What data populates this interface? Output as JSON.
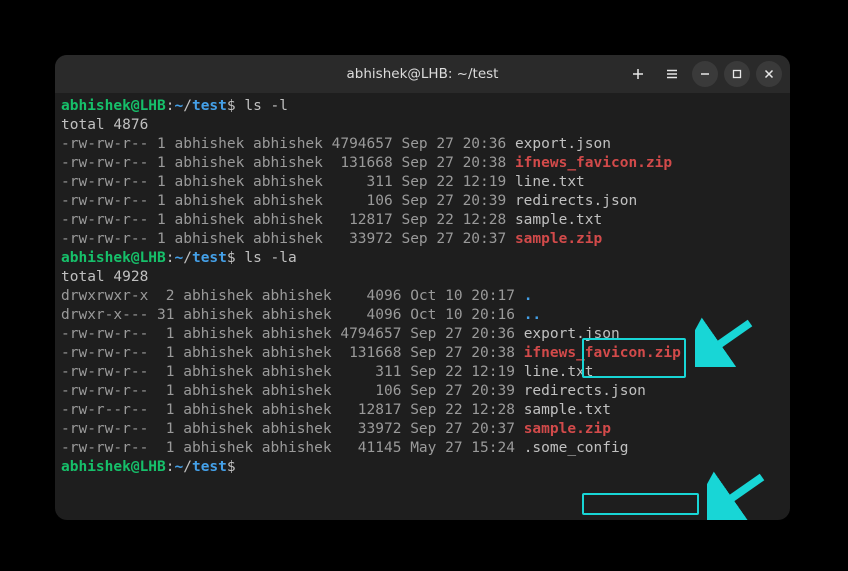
{
  "window": {
    "title": "abhishek@LHB: ~/test"
  },
  "prompt": {
    "user_host": "abhishek@LHB",
    "colon": ":",
    "tilde": "~",
    "slash": "/",
    "dir": "test",
    "dollar": "$ "
  },
  "cmd1": "ls -l",
  "total1": "total 4876",
  "ls1": [
    {
      "perm": "-rw-rw-r--",
      "ln": "1",
      "u": "abhishek",
      "g": "abhishek",
      "sz": "4794657",
      "dt": "Sep 27 20:36",
      "name": "export.json",
      "cls": ""
    },
    {
      "perm": "-rw-rw-r--",
      "ln": "1",
      "u": "abhishek",
      "g": "abhishek",
      "sz": " 131668",
      "dt": "Sep 27 20:38",
      "name": "ifnews_favicon.zip",
      "cls": "file-zip"
    },
    {
      "perm": "-rw-rw-r--",
      "ln": "1",
      "u": "abhishek",
      "g": "abhishek",
      "sz": "    311",
      "dt": "Sep 22 12:19",
      "name": "line.txt",
      "cls": ""
    },
    {
      "perm": "-rw-rw-r--",
      "ln": "1",
      "u": "abhishek",
      "g": "abhishek",
      "sz": "    106",
      "dt": "Sep 27 20:39",
      "name": "redirects.json",
      "cls": ""
    },
    {
      "perm": "-rw-rw-r--",
      "ln": "1",
      "u": "abhishek",
      "g": "abhishek",
      "sz": "  12817",
      "dt": "Sep 22 12:28",
      "name": "sample.txt",
      "cls": ""
    },
    {
      "perm": "-rw-rw-r--",
      "ln": "1",
      "u": "abhishek",
      "g": "abhishek",
      "sz": "  33972",
      "dt": "Sep 27 20:37",
      "name": "sample.zip",
      "cls": "file-zip"
    }
  ],
  "cmd2": "ls -la",
  "total2": "total 4928",
  "ls2": [
    {
      "perm": "drwxrwxr-x",
      "ln": " 2",
      "u": "abhishek",
      "g": "abhishek",
      "sz": "   4096",
      "dt": "Oct 10 20:17",
      "name": ".",
      "cls": "file-dir"
    },
    {
      "perm": "drwxr-x---",
      "ln": "31",
      "u": "abhishek",
      "g": "abhishek",
      "sz": "   4096",
      "dt": "Oct 10 20:16",
      "name": "..",
      "cls": "file-dir"
    },
    {
      "perm": "-rw-rw-r--",
      "ln": " 1",
      "u": "abhishek",
      "g": "abhishek",
      "sz": "4794657",
      "dt": "Sep 27 20:36",
      "name": "export.json",
      "cls": ""
    },
    {
      "perm": "-rw-rw-r--",
      "ln": " 1",
      "u": "abhishek",
      "g": "abhishek",
      "sz": " 131668",
      "dt": "Sep 27 20:38",
      "name": "ifnews_favicon.zip",
      "cls": "file-zip"
    },
    {
      "perm": "-rw-rw-r--",
      "ln": " 1",
      "u": "abhishek",
      "g": "abhishek",
      "sz": "    311",
      "dt": "Sep 22 12:19",
      "name": "line.txt",
      "cls": ""
    },
    {
      "perm": "-rw-rw-r--",
      "ln": " 1",
      "u": "abhishek",
      "g": "abhishek",
      "sz": "    106",
      "dt": "Sep 27 20:39",
      "name": "redirects.json",
      "cls": ""
    },
    {
      "perm": "-rw-r--r--",
      "ln": " 1",
      "u": "abhishek",
      "g": "abhishek",
      "sz": "  12817",
      "dt": "Sep 22 12:28",
      "name": "sample.txt",
      "cls": ""
    },
    {
      "perm": "-rw-rw-r--",
      "ln": " 1",
      "u": "abhishek",
      "g": "abhishek",
      "sz": "  33972",
      "dt": "Sep 27 20:37",
      "name": "sample.zip",
      "cls": "file-zip"
    },
    {
      "perm": "-rw-rw-r--",
      "ln": " 1",
      "u": "abhishek",
      "g": "abhishek",
      "sz": "  41145",
      "dt": "May 27 15:24",
      "name": ".some_config",
      "cls": ""
    }
  ]
}
